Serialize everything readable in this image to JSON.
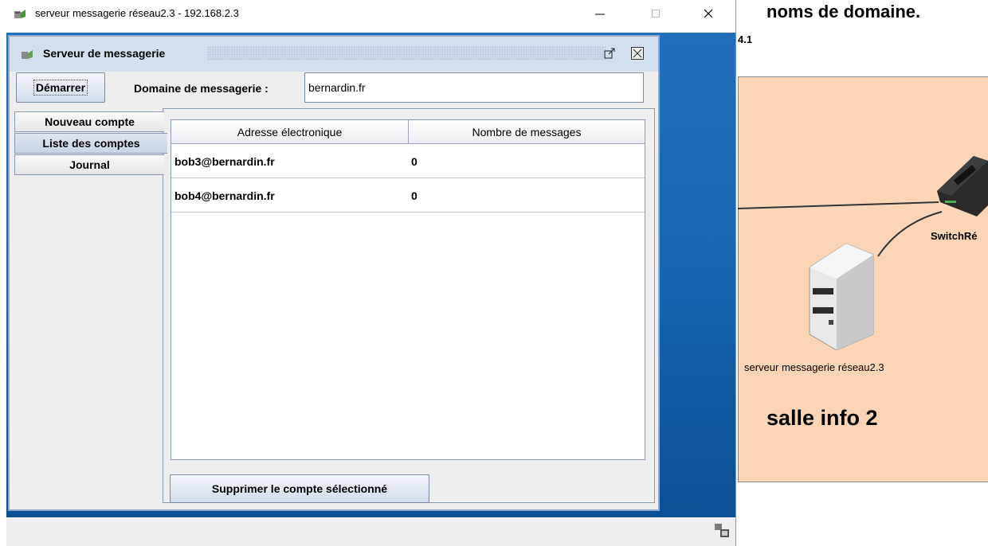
{
  "window": {
    "title": "serveur messagerie réseau2.3 - 192.168.2.3"
  },
  "frame": {
    "title": "Serveur de messagerie"
  },
  "toolbar": {
    "start_label": "Démarrer",
    "domain_label": "Domaine de messagerie :",
    "domain_value": "bernardin.fr"
  },
  "tabs": [
    {
      "label": "Nouveau compte",
      "selected": false
    },
    {
      "label": "Liste des comptes",
      "selected": true
    },
    {
      "label": "Journal",
      "selected": false
    }
  ],
  "table": {
    "columns": [
      "Adresse électronique",
      "Nombre de messages"
    ],
    "rows": [
      {
        "email": "bob3@bernardin.fr",
        "messages": "0"
      },
      {
        "email": "bob4@bernardin.fr",
        "messages": "0"
      }
    ]
  },
  "delete_label": "Supprimer le compte sélectionné",
  "background": {
    "heading": "noms de domaine.",
    "small_text": "4.1",
    "switch_label": "SwitchRé",
    "server_label": "serveur messagerie réseau2.3",
    "room_label": "salle info 2",
    "room_color": "#fbd5b5"
  },
  "colors": {
    "desktop": "#1867b4",
    "frame_title": "#d4dfee"
  }
}
